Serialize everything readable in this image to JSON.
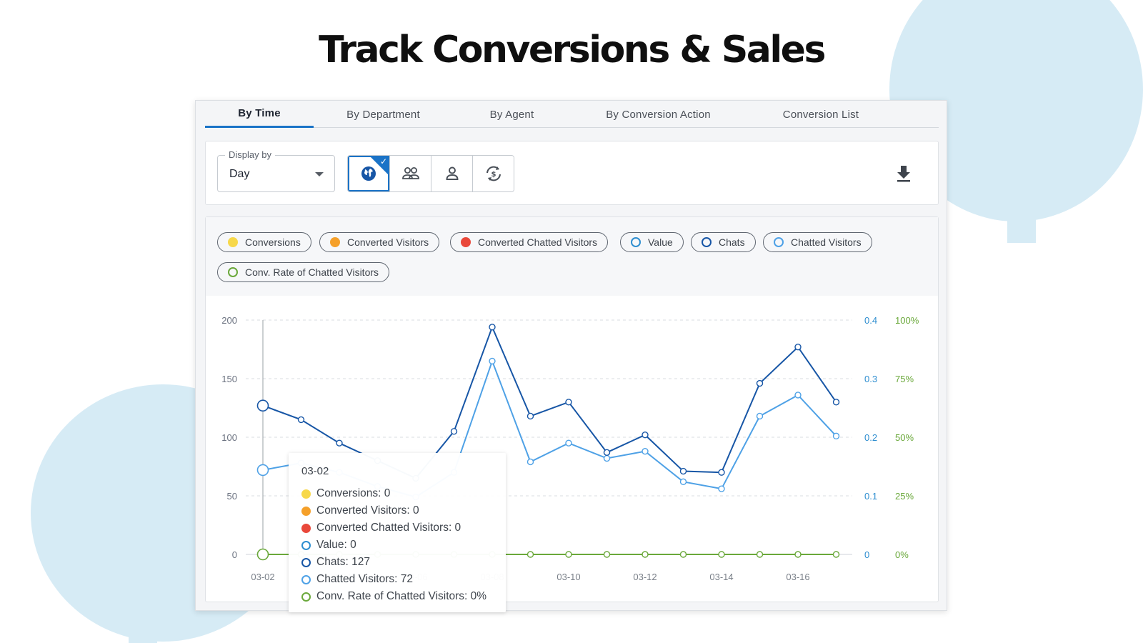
{
  "page": {
    "title": "Track Conversions & Sales"
  },
  "tabs": [
    {
      "label": "By Time",
      "active": true
    },
    {
      "label": "By Department",
      "active": false
    },
    {
      "label": "By Agent",
      "active": false
    },
    {
      "label": "By Conversion Action",
      "active": false
    },
    {
      "label": "Conversion List",
      "active": false
    }
  ],
  "toolbar": {
    "display_by": {
      "label": "Display by",
      "value": "Day"
    },
    "view_buttons": [
      {
        "icon": "globe-icon",
        "selected": true
      },
      {
        "icon": "group-icon",
        "selected": false
      },
      {
        "icon": "person-icon",
        "selected": false
      },
      {
        "icon": "conversion-cycle-icon",
        "selected": false
      }
    ],
    "download_icon": "download-icon"
  },
  "legend": [
    {
      "label": "Conversions",
      "color": "#f7d84a",
      "filled": true
    },
    {
      "label": "Converted Visitors",
      "color": "#f5a02a",
      "filled": true
    },
    {
      "label": "Converted Chatted Visitors",
      "color": "#e9483a",
      "filled": true
    },
    {
      "label": "Value",
      "color": "#2e8ed0",
      "filled": false
    },
    {
      "label": "Chats",
      "color": "#1756a6",
      "filled": false
    },
    {
      "label": "Chatted Visitors",
      "color": "#4ea1e6",
      "filled": false
    },
    {
      "label": "Conv. Rate of Chatted Visitors",
      "color": "#6aa83a",
      "filled": false
    }
  ],
  "tooltip": {
    "title": "03-02",
    "rows": [
      {
        "text": "Conversions: 0",
        "color": "#f7d84a",
        "filled": true
      },
      {
        "text": "Converted Visitors: 0",
        "color": "#f5a02a",
        "filled": true
      },
      {
        "text": "Converted Chatted Visitors: 0",
        "color": "#e9483a",
        "filled": true
      },
      {
        "text": "Value: 0",
        "color": "#2e8ed0",
        "filled": false
      },
      {
        "text": "Chats: 127",
        "color": "#1756a6",
        "filled": false
      },
      {
        "text": "Chatted Visitors: 72",
        "color": "#4ea1e6",
        "filled": false
      },
      {
        "text": "Conv. Rate of Chatted Visitors: 0%",
        "color": "#6aa83a",
        "filled": false
      }
    ]
  },
  "chart_data": {
    "type": "line",
    "x": [
      "03-02",
      "03-03",
      "03-04",
      "03-05",
      "03-06",
      "03-07",
      "03-08",
      "03-09",
      "03-10",
      "03-11",
      "03-12",
      "03-13",
      "03-14",
      "03-15",
      "03-16",
      "03-17"
    ],
    "x_tick_labels": [
      "03-02",
      "03-04",
      "03-06",
      "03-08",
      "03-10",
      "03-12",
      "03-14",
      "03-16"
    ],
    "y_left": {
      "ticks": [
        "200",
        "150",
        "100",
        "50",
        "0"
      ],
      "ylim": [
        0,
        200
      ],
      "color": "#6b7280"
    },
    "y_right": {
      "ticks": [
        "0.4",
        "0.3",
        "0.2",
        "0.1",
        "0"
      ],
      "ylim": [
        0,
        0.4
      ],
      "color": "#2e8ed0"
    },
    "y_right2": {
      "ticks": [
        "100%",
        "75%",
        "50%",
        "25%",
        "0%"
      ],
      "ylim": [
        0,
        100
      ],
      "color": "#6aa83a"
    },
    "grid": true,
    "hover_index": 0,
    "series": [
      {
        "name": "Chats",
        "color": "#1756a6",
        "axis": "left",
        "values": [
          127,
          115,
          95,
          80,
          65,
          105,
          194,
          118,
          130,
          87,
          102,
          71,
          70,
          146,
          177,
          130
        ]
      },
      {
        "name": "Chatted Visitors",
        "color": "#4ea1e6",
        "axis": "left",
        "values": [
          72,
          78,
          70,
          58,
          49,
          70,
          165,
          79,
          95,
          82,
          88,
          62,
          56,
          118,
          136,
          101
        ]
      },
      {
        "name": "Conv. Rate of Chatted Visitors",
        "color": "#6aa83a",
        "axis": "right2",
        "values": [
          0,
          0,
          0,
          0,
          0,
          0,
          0,
          0,
          0,
          0,
          0,
          0,
          0,
          0,
          0,
          0
        ]
      }
    ]
  }
}
